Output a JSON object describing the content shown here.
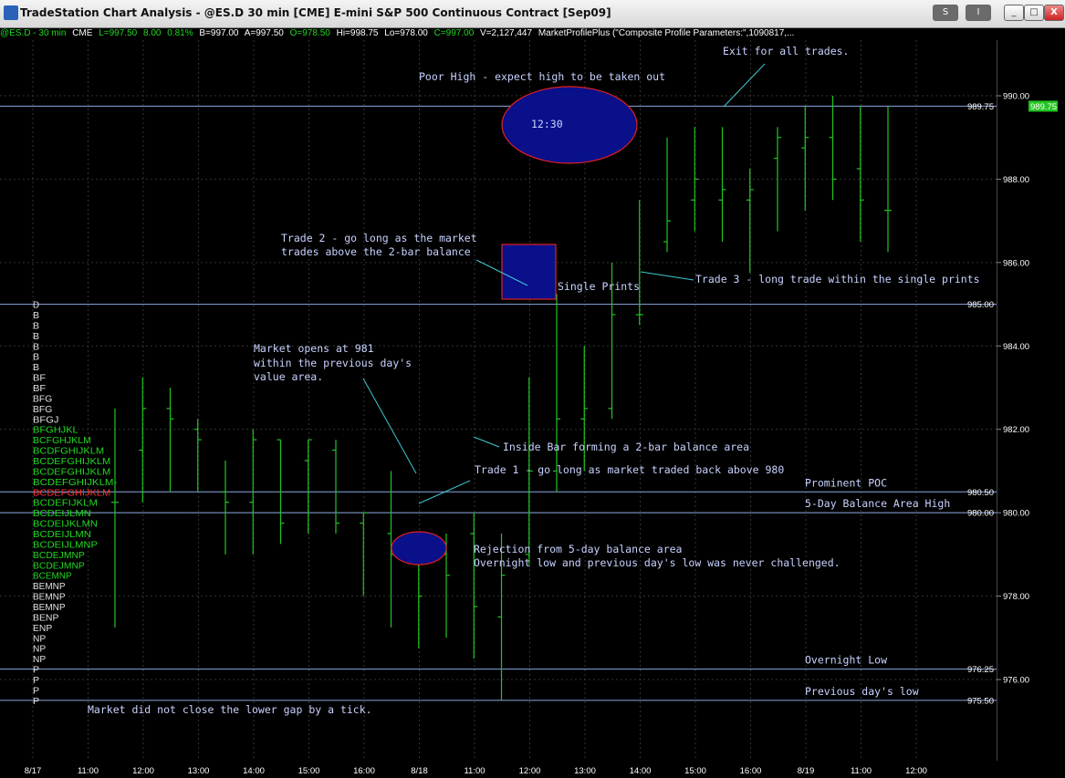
{
  "window": {
    "title": "TradeStation Chart Analysis - @ES.D 30 min [CME] E-mini S&P 500 Continuous Contract [Sep09]",
    "buttons": {
      "s": "S",
      "i": "I",
      "minimize": "_",
      "maximize": "□",
      "close": "X"
    }
  },
  "status": {
    "symbol": "@ES.D - 30 min",
    "exchange": "CME",
    "last": "L=997.50",
    "change": "8.00",
    "pct": "0.81%",
    "bid": "B=997.00",
    "ask": "A=997.50",
    "open": "O=978.50",
    "high": "Hi=998.75",
    "low": "Lo=978.00",
    "close": "C=997.00",
    "volume": "V=2,127,447",
    "indicator": "MarketProfilePlus (\"Composite Profile Parameters:\",1090817,..."
  },
  "colors": {
    "bars": "#22c422",
    "hline": "#8aa8e0",
    "ellipse_fill": "#0a0f8a",
    "ellipse_stroke": "#e02020",
    "text": "#c8d2ff",
    "last_price_bg": "#22c422"
  },
  "chart_data": {
    "type": "bar",
    "ylim": [
      975.0,
      990.75
    ],
    "y_ticks": [
      "990.00",
      "988.00",
      "986.00",
      "984.00",
      "982.00",
      "980.00",
      "978.00",
      "976.00"
    ],
    "x_labels": [
      "8/17",
      "11:00",
      "12:00",
      "13:00",
      "14:00",
      "15:00",
      "16:00",
      "8/18",
      "11:00",
      "12:00",
      "13:00",
      "14:00",
      "15:00",
      "16:00",
      "8/19",
      "11:00",
      "12:00"
    ],
    "levels": [
      {
        "value": 989.75,
        "tag": "989.75",
        "label": ""
      },
      {
        "value": 985.0,
        "tag": "985.00",
        "label": ""
      },
      {
        "value": 980.5,
        "tag": "980.50",
        "label": "Prominent POC"
      },
      {
        "value": 980.0,
        "tag": "980.00",
        "label": "5-Day Balance Area High"
      },
      {
        "value": 976.25,
        "tag": "976.25",
        "label": "Overnight Low"
      },
      {
        "value": 975.5,
        "tag": "975.50",
        "label": "Previous day's low"
      }
    ],
    "last_price": "989.75",
    "bars": [
      {
        "i": 1,
        "h": 982.5,
        "l": 977.25,
        "o": 980.25,
        "c": 980.25
      },
      {
        "i": 2,
        "h": 983.25,
        "l": 980.25,
        "o": 981.5,
        "c": 982.5
      },
      {
        "i": 3,
        "h": 983.0,
        "l": 980.5,
        "o": 982.5,
        "c": 982.25
      },
      {
        "i": 4,
        "h": 982.25,
        "l": 980.5,
        "o": 982.0,
        "c": 981.75
      },
      {
        "i": 5,
        "h": 981.25,
        "l": 979.0,
        "o": 980.5,
        "c": 980.25
      },
      {
        "i": 6,
        "h": 982.0,
        "l": 979.0,
        "o": 980.25,
        "c": 981.75
      },
      {
        "i": 7,
        "h": 981.75,
        "l": 979.25,
        "o": 981.75,
        "c": 979.75
      },
      {
        "i": 8,
        "h": 981.75,
        "l": 979.5,
        "o": 981.25,
        "c": 981.75
      },
      {
        "i": 9,
        "h": 981.75,
        "l": 979.5,
        "o": 981.5,
        "c": 979.75
      },
      {
        "i": 10,
        "h": 980.0,
        "l": 978.0,
        "o": 979.75,
        "c": 980.0
      },
      {
        "i": 11,
        "h": 981.0,
        "l": 977.25,
        "o": 979.5,
        "c": 979.0
      },
      {
        "i": 12,
        "h": 979.5,
        "l": 976.75,
        "o": 979.0,
        "c": 978.0
      },
      {
        "i": 13,
        "h": 979.5,
        "l": 977.0,
        "o": 979.0,
        "c": 978.5
      },
      {
        "i": 14,
        "h": 980.0,
        "l": 976.5,
        "o": 979.5,
        "c": 977.75
      },
      {
        "i": 15,
        "h": 979.5,
        "l": 975.5,
        "o": 977.5,
        "c": 978.5
      },
      {
        "i": 16,
        "h": 983.25,
        "l": 978.75,
        "o": 979.0,
        "c": 981.0
      },
      {
        "i": 17,
        "h": 985.25,
        "l": 980.5,
        "o": 981.0,
        "c": 982.25
      },
      {
        "i": 18,
        "h": 984.0,
        "l": 981.0,
        "o": 982.25,
        "c": 982.5
      },
      {
        "i": 19,
        "h": 986.0,
        "l": 982.25,
        "o": 982.5,
        "c": 984.75
      },
      {
        "i": 20,
        "h": 987.5,
        "l": 984.5,
        "o": 984.75,
        "c": 984.75
      },
      {
        "i": 21,
        "h": 989.0,
        "l": 986.25,
        "o": 986.5,
        "c": 987.0
      },
      {
        "i": 22,
        "h": 989.25,
        "l": 986.75,
        "o": 987.5,
        "c": 988.0
      },
      {
        "i": 23,
        "h": 989.25,
        "l": 986.5,
        "o": 987.5,
        "c": 987.75
      },
      {
        "i": 24,
        "h": 988.25,
        "l": 985.75,
        "o": 987.5,
        "c": 987.75
      },
      {
        "i": 25,
        "h": 989.25,
        "l": 986.75,
        "o": 988.5,
        "c": 989.0
      },
      {
        "i": 26,
        "h": 989.75,
        "l": 987.25,
        "o": 988.75,
        "c": 989.0
      },
      {
        "i": 27,
        "h": 990.0,
        "l": 987.5,
        "o": 989.0,
        "c": 988.0
      },
      {
        "i": 28,
        "h": 989.75,
        "l": 986.5,
        "o": 988.25,
        "c": 987.5
      },
      {
        "i": 29,
        "h": 989.75,
        "l": 986.25,
        "o": 987.25,
        "c": 987.25
      }
    ]
  },
  "profile": {
    "rows": [
      "D",
      "B",
      "B",
      "B",
      "B",
      "B",
      "B",
      "BF",
      "BF",
      "BFG",
      "BFG",
      "BFGJ",
      "BFGHJKL",
      "BCFGHJKLM",
      "BCDFGHIJKLM",
      "BCDEFGHIJKLM",
      "BCDEFGHIJKLM",
      "BCDEFGHIJKLM-",
      "BCDEFGHIJKLM",
      "BCDEFIJKLM",
      "BCDEIJLMN",
      "BCDEIJKLMN",
      "BCDEIJLMN",
      "BCDEIJLMNP",
      "BCDEJMNP",
      "BCDEJMNP",
      "BCEMNP",
      "BEMNP",
      "BEMNP",
      "BEMNP",
      "BENP",
      "ENP",
      "NP",
      "NP",
      "NP",
      "P",
      "P",
      "P",
      "P"
    ],
    "row_colors": [
      "#e0e0e0",
      "#e0e0e0",
      "#e0e0e0",
      "#e0e0e0",
      "#e0e0e0",
      "#e0e0e0",
      "#e0e0e0",
      "#e0e0e0",
      "#e0e0e0",
      "#e0e0e0",
      "#e0e0e0",
      "#e0e0e0",
      "#22d622",
      "#22d622",
      "#22d622",
      "#22d622",
      "#22d622",
      "#22d622",
      "#ff3030",
      "#22d622",
      "#22d622",
      "#22d622",
      "#22d622",
      "#22d622",
      "#22d622",
      "#22d622",
      "#22d622",
      "#e0e0e0",
      "#e0e0e0",
      "#e0e0e0",
      "#e0e0e0",
      "#e0e0e0",
      "#e0e0e0",
      "#e0e0e0",
      "#e0e0e0",
      "#e0e0e0",
      "#e0e0e0",
      "#e0e0e0",
      "#e0e0e0"
    ]
  },
  "annotations": {
    "exit": "Exit for all trades.",
    "poor_high": "Poor High - expect high to be taken out",
    "time_1230": "12:30",
    "trade2_line1": "Trade 2 - go long as the market",
    "trade2_line2": "trades above the 2-bar balance",
    "single_prints": "Single Prints",
    "trade3": "Trade 3 - long trade within the single prints",
    "open_line1": "Market opens at 981",
    "open_line2": "within the previous day's",
    "open_line3": "value area.",
    "inside_bar": "Inside Bar forming a 2-bar balance area",
    "trade1": "Trade 1 - go long as market traded back above 980",
    "rejection_line1": "Rejection from 5-day balance area",
    "rejection_line2": "Overnight low and previous day's low was never challenged.",
    "gap": "Market did not close the lower gap by a tick."
  }
}
